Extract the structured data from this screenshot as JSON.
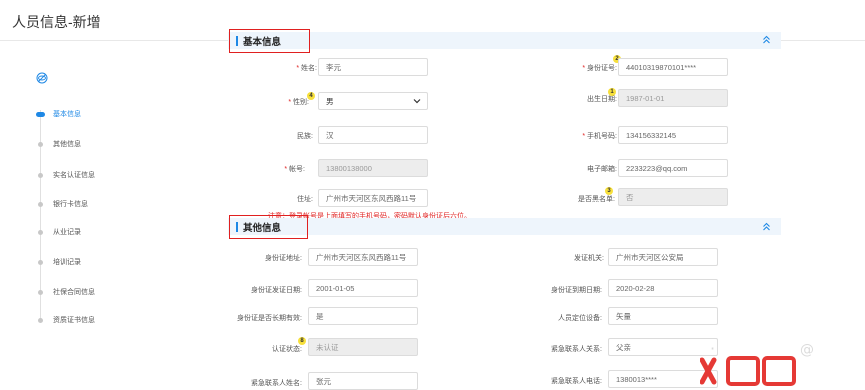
{
  "header": {
    "title": "人员信息-新增"
  },
  "sidebar": {
    "items": [
      {
        "label": "基本信息",
        "active": true
      },
      {
        "label": "其他信息"
      },
      {
        "label": "实名认证信息"
      },
      {
        "label": "银行卡信息"
      },
      {
        "label": "从业记录"
      },
      {
        "label": "培训记录"
      },
      {
        "label": "社保合同信息"
      },
      {
        "label": "资质证书信息"
      }
    ]
  },
  "basic": {
    "section_title": "基本信息",
    "name_label": "姓名:",
    "name_value": "李元",
    "idcard_label": "身份证号:",
    "idcard_value": "44010319870101****",
    "gender_label": "性别:",
    "gender_value": "男",
    "birth_label": "出生日期:",
    "birth_value": "1987-01-01",
    "ethnic_label": "民族:",
    "ethnic_value": "汉",
    "phone_label": "手机号码:",
    "phone_value": "134156332145",
    "account_label": "帐号:",
    "account_value": "13800138000",
    "email_label": "电子邮箱:",
    "email_value": "2233223@qq.com",
    "address_label": "住址:",
    "address_value": "广州市天河区东风西路11号",
    "blacklist_label": "是否黑名单:",
    "blacklist_value": "否",
    "note": "注意：登录帐号是上面填写的手机号码，密码默认身份证后六位。"
  },
  "other": {
    "section_title": "其他信息",
    "id_address_label": "身份证地址:",
    "id_address_value": "广州市天河区东风西路11号",
    "issuer_label": "发证机关:",
    "issuer_value": "广州市天河区公安局",
    "issue_date_label": "身份证发证日期:",
    "issue_date_value": "2001-01-05",
    "expire_label": "身份证到期日期:",
    "expire_value": "2020-02-28",
    "longterm_label": "身份证是否长期有效:",
    "longterm_value": "是",
    "locator_label": "人员定位设备:",
    "locator_value": "矢量",
    "auth_label": "认证状态:",
    "auth_value": "未认证",
    "emg_rel_label": "紧急联系人关系:",
    "emg_rel_value": "父亲",
    "emg_name_label": "紧急联系人姓名:",
    "emg_name_value": "张元",
    "emg_phone_label": "紧急联系人电话:",
    "emg_phone_value": "1380013****"
  },
  "badges": {
    "b1": "1",
    "b2": "2",
    "b3": "3",
    "b4": "4",
    "b8": "8"
  },
  "colors": {
    "accent": "#1e88e5",
    "required": "#e02020",
    "highlight": "#e02020",
    "badge": "#f7e03c"
  },
  "icons": {
    "visibility": "eye-icon",
    "collapse": "double-chevron-up-icon",
    "select": "chevron-down-icon"
  }
}
